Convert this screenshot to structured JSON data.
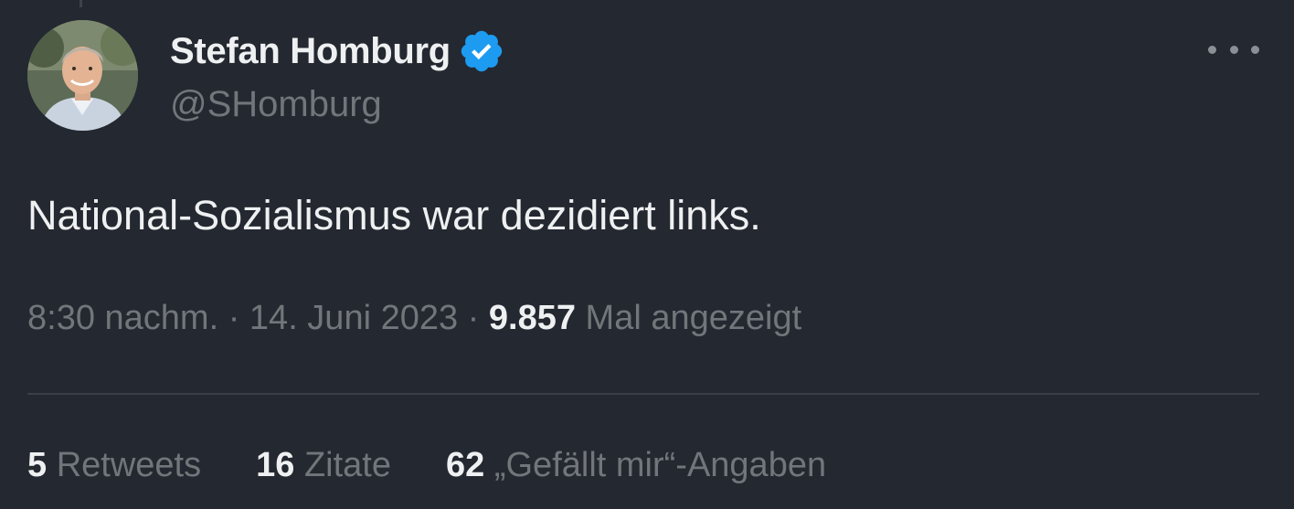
{
  "author": {
    "display_name": "Stefan Homburg",
    "handle": "@SHomburg",
    "verified_color": "#1d9bf0"
  },
  "tweet": {
    "text": "National-Sozialismus war dezidiert links.",
    "time": "8:30 nachm.",
    "separator": "·",
    "date": "14. Juni 2023",
    "views_count": "9.857",
    "views_label": "Mal angezeigt"
  },
  "stats": {
    "retweets_count": "5",
    "retweets_label": "Retweets",
    "quotes_count": "16",
    "quotes_label": "Zitate",
    "likes_count": "62",
    "likes_label": "„Gefällt mir“-Angaben"
  },
  "icons": {
    "more": "more-horizontal-icon",
    "verified": "verified-badge-icon"
  },
  "colors": {
    "background": "#242830",
    "text_primary": "#eef0f1",
    "text_secondary": "#71767b",
    "divider": "#3a3f47"
  }
}
